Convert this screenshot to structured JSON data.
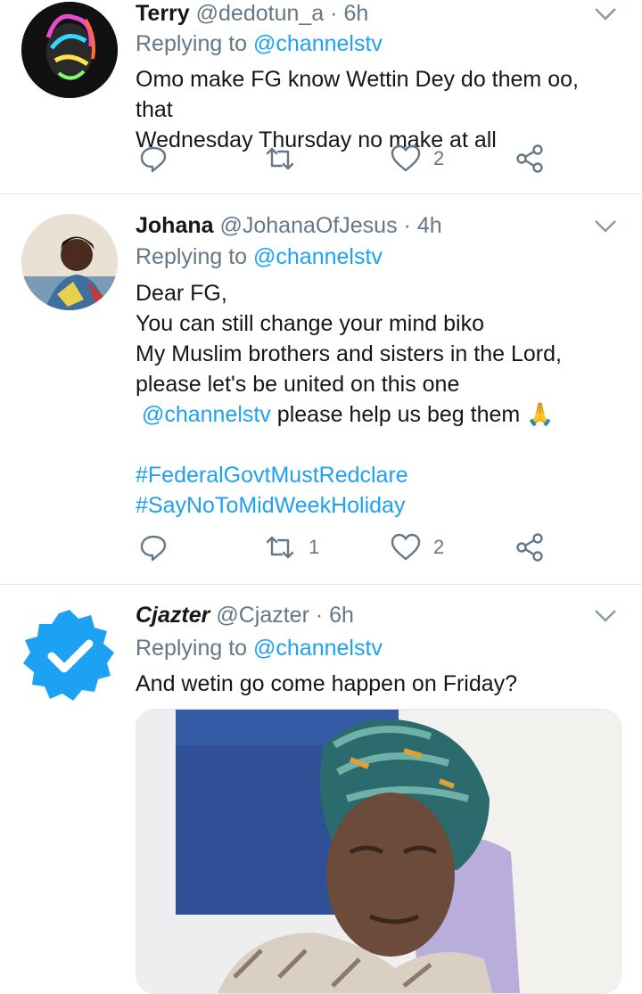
{
  "tweets": [
    {
      "name": "Terry",
      "handle": "@dedotun_a",
      "dot": "·",
      "time": "6h",
      "replying_prefix": "Replying to ",
      "replying_to": "@channelstv",
      "text_lines": [
        "Omo make FG know Wettin Dey do them oo, that",
        "Wednesday Thursday no make at all"
      ],
      "retweets": "",
      "likes": "2"
    },
    {
      "name": "Johana",
      "handle": "@JohanaOfJesus",
      "dot": "·",
      "time": "4h",
      "replying_prefix": "Replying to ",
      "replying_to": "@channelstv",
      "text_lines": [
        "Dear FG,",
        "You can still change your mind biko",
        "My Muslim brothers and sisters in the Lord,",
        "please let's be united on this one"
      ],
      "mention_line_mention": "@channelstv",
      "mention_line_text": " please help us beg them 🙏",
      "hashtags": [
        "#FederalGovtMustRedclare",
        "#SayNoToMidWeekHoliday"
      ],
      "retweets": "1",
      "likes": "2"
    },
    {
      "name": "Cjazter",
      "handle": "@Cjazter",
      "dot": "·",
      "time": "6h",
      "replying_prefix": "Replying to ",
      "replying_to": "@channelstv",
      "text_lines": [
        "And wetin go come happen on Friday?"
      ]
    }
  ],
  "icons": {
    "reply": "reply-icon",
    "retweet": "retweet-icon",
    "like": "heart-icon",
    "share": "share-icon",
    "more": "chevron-down-icon",
    "verified": "verified-badge-icon"
  },
  "colors": {
    "accent": "#1da1f2",
    "secondary_text": "#657786",
    "divider": "#e1e8ed"
  }
}
